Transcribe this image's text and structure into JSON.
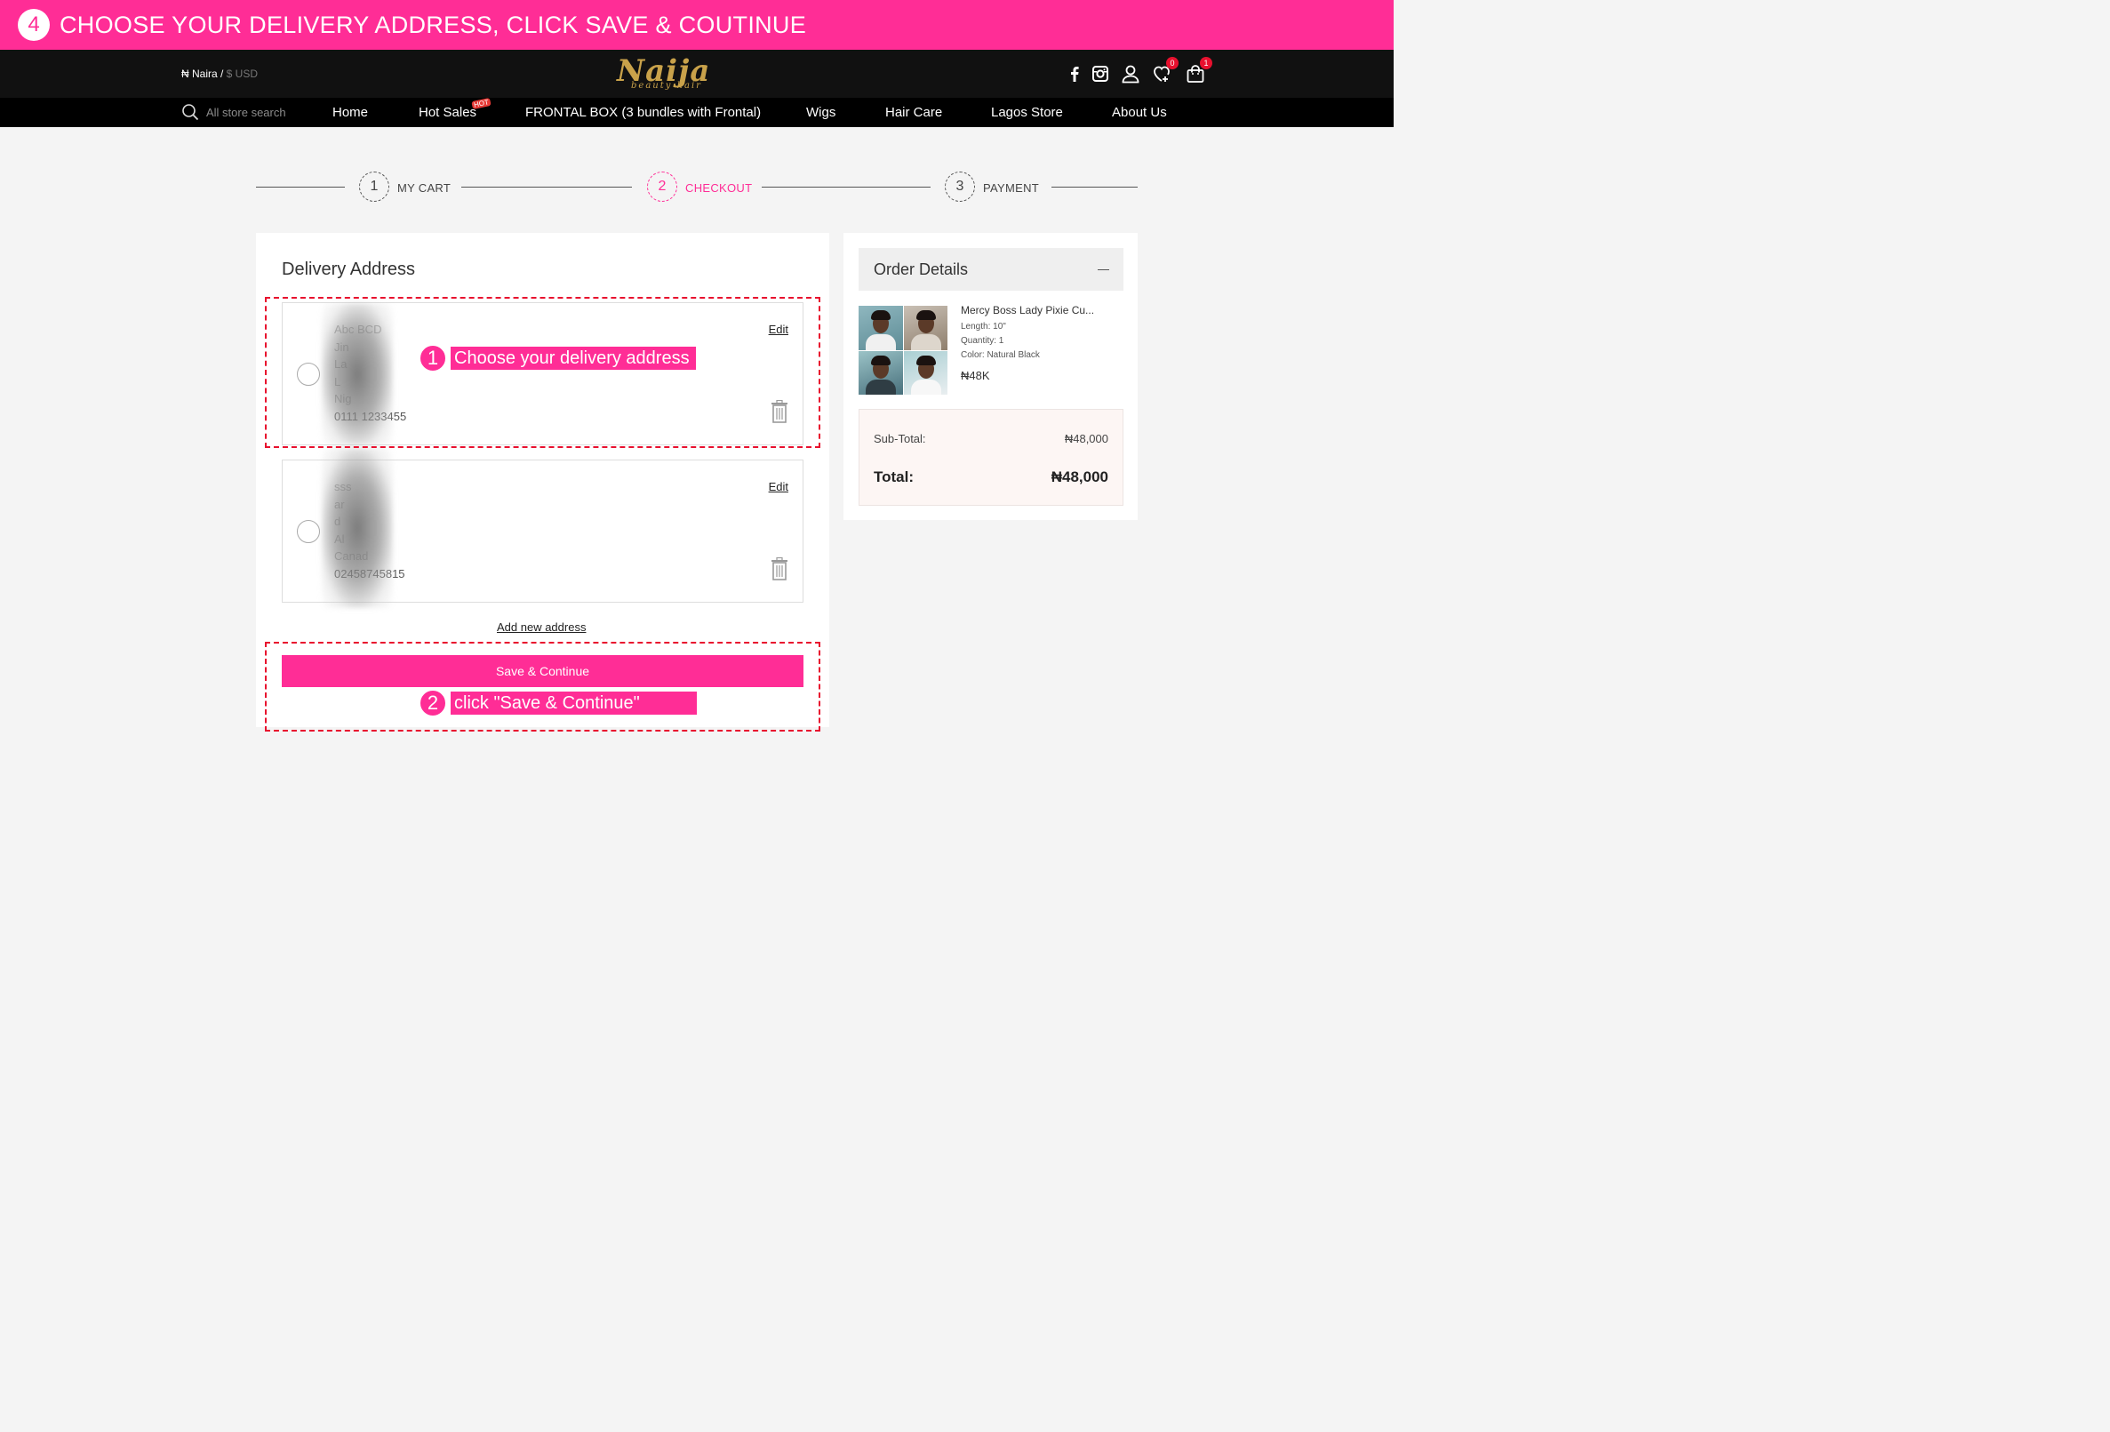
{
  "banner": {
    "step_number": "4",
    "text": "CHOOSE YOUR DELIVERY ADDRESS, CLICK SAVE & COUTINUE",
    "color": "#ff2d96"
  },
  "header": {
    "currency_naira": "₦ Naira /",
    "currency_usd": " $ USD",
    "logo_main": "Naija",
    "logo_sub": "beauty hair",
    "icons": [
      "facebook-icon",
      "instagram-icon",
      "user-icon",
      "wishlist-icon",
      "cart-icon"
    ],
    "wishlist_count": "0",
    "cart_count": "1"
  },
  "nav": {
    "search_placeholder": "All store search",
    "items": [
      "Home",
      "Hot Sales",
      "FRONTAL BOX (3 bundles with Frontal)",
      "Wigs",
      "Hair Care",
      "Lagos Store",
      "About Us"
    ],
    "hot_flag": "HOT"
  },
  "stepper": {
    "steps": [
      {
        "number": "1",
        "label": "MY CART"
      },
      {
        "number": "2",
        "label": "CHECKOUT"
      },
      {
        "number": "3",
        "label": "PAYMENT"
      }
    ],
    "active_step": 2,
    "active_color": "#ff2d96"
  },
  "delivery": {
    "title": "Delivery Address",
    "addresses": [
      {
        "lines": [
          "Abc BCD",
          "Jin",
          "La",
          "L",
          "Nig"
        ],
        "phone": "0111 1233455",
        "edit_label": "Edit"
      },
      {
        "lines": [
          "sss",
          "ar",
          "d",
          "Al",
          "Canad"
        ],
        "phone": "02458745815",
        "edit_label": "Edit"
      }
    ],
    "add_new_label": "Add new address",
    "save_label": "Save & Continue"
  },
  "annotations": [
    {
      "number": "1",
      "text": "Choose your delivery address"
    },
    {
      "number": "2",
      "text": "click \"Save & Continue\""
    }
  ],
  "order": {
    "title": "Order Details",
    "product": {
      "name": "Mercy Boss Lady Pixie Cu...",
      "length": "Length: 10\"",
      "quantity": "Quantity: 1",
      "color": "Color: Natural Black",
      "price": "₦48K"
    },
    "subtotal_label": "Sub-Total:",
    "subtotal_value": "₦48,000",
    "total_label": "Total:",
    "total_value": "₦48,000"
  }
}
